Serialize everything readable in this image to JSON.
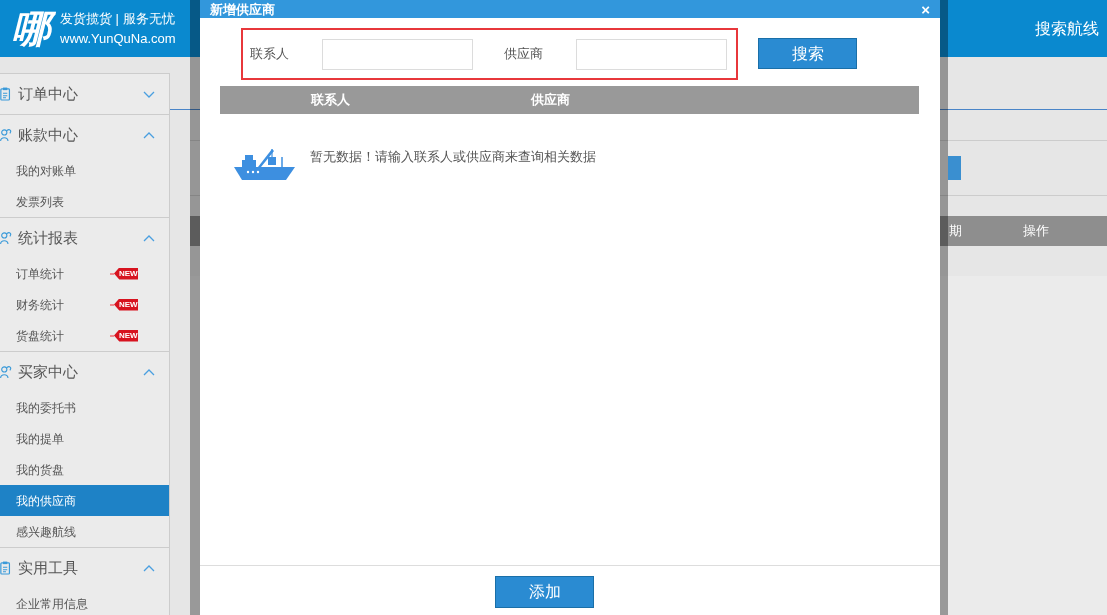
{
  "header": {
    "logo": "哪",
    "slogan": "发货揽货 | 服务无忧",
    "website": "www.YunQuNa.com",
    "nav_link": "搜索航线"
  },
  "sidebar": {
    "groups": [
      {
        "label": "订单中心",
        "kind": "document",
        "expanded": false
      },
      {
        "label": "账款中心",
        "kind": "contacts",
        "expanded": true,
        "items": [
          {
            "label": "我的对账单",
            "selected": false
          },
          {
            "label": "发票列表",
            "selected": false
          }
        ]
      },
      {
        "label": "统计报表",
        "kind": "contacts",
        "expanded": true,
        "items": [
          {
            "label": "订单统计",
            "selected": false,
            "badge": "NEW"
          },
          {
            "label": "财务统计",
            "selected": false,
            "badge": "NEW"
          },
          {
            "label": "货盘统计",
            "selected": false,
            "badge": "NEW"
          }
        ]
      },
      {
        "label": "买家中心",
        "kind": "contacts",
        "expanded": true,
        "items": [
          {
            "label": "我的委托书",
            "selected": false
          },
          {
            "label": "我的提单",
            "selected": false
          },
          {
            "label": "我的货盘",
            "selected": false
          },
          {
            "label": "我的供应商",
            "selected": true
          },
          {
            "label": "感兴趣航线",
            "selected": false
          }
        ]
      },
      {
        "label": "实用工具",
        "kind": "document",
        "expanded": true,
        "items": [
          {
            "label": "企业常用信息",
            "selected": false
          }
        ]
      }
    ]
  },
  "background_table": {
    "columns": [
      "期",
      "操作"
    ]
  },
  "dialog": {
    "title": "新增供应商",
    "close": "×",
    "search": {
      "fields": [
        {
          "label": "联系人"
        },
        {
          "label": "供应商"
        }
      ],
      "button": "搜索"
    },
    "table": {
      "columns": [
        "联系人",
        "供应商"
      ]
    },
    "empty_message": "暂无数据！请输入联系人或供应商来查询相关数据",
    "button": "添加"
  }
}
